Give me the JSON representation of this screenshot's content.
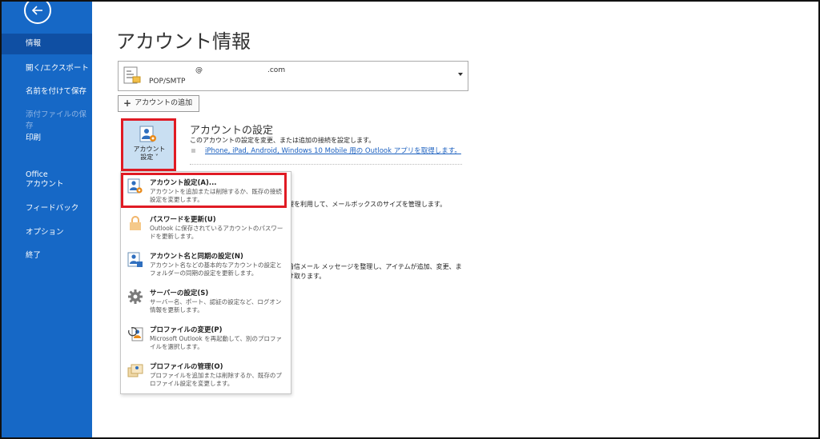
{
  "sidebar": {
    "items": [
      {
        "label": "情報"
      },
      {
        "label": "開く/エクスポート"
      },
      {
        "label": "名前を付けて保存"
      },
      {
        "label": "添付ファイルの保存"
      },
      {
        "label": "印刷"
      },
      {
        "label": "Office\nアカウント"
      },
      {
        "label": "フィードバック"
      },
      {
        "label": "オプション"
      },
      {
        "label": "終了"
      }
    ]
  },
  "main": {
    "title": "アカウント情報",
    "account": {
      "email_at": "@",
      "email_domain": ".com",
      "type": "POP/SMTP"
    },
    "add_account_label": "アカウントの追加",
    "settings_tile_label": "アカウント\n設定 ˅",
    "section": {
      "title": "アカウントの設定",
      "description": "このアカウントの設定を変更、または追加の接続を設定します。",
      "link": "iPhone, iPad, Android, Windows 10 Mobile 用の Outlook アプリを取得します。"
    },
    "background_text": {
      "line1": "理を利用して、メールボックスのサイズを管理します。",
      "line2": "着信メール メッセージを整理し、アイテムが追加、変更、ま",
      "line3": "け取ります。"
    }
  },
  "menu": {
    "items": [
      {
        "title": "アカウント設定(A)...",
        "desc": "アカウントを追加または削除するか、既存の接続設定を変更します。"
      },
      {
        "title": "パスワードを更新(U)",
        "desc": "Outlook に保存されているアカウントのパスワードを更新します。"
      },
      {
        "title": "アカウント名と同期の設定(N)",
        "desc": "アカウント名などの基本的なアカウントの設定とフォルダーの同期の設定を更新します。"
      },
      {
        "title": "サーバーの設定(S)",
        "desc": "サーバー名、ポート、認証の設定など、ログオン情報を更新します。"
      },
      {
        "title": "プロファイルの変更(P)",
        "desc": "Microsoft Outlook を再起動して、別のプロファイルを選択します。"
      },
      {
        "title": "プロファイルの管理(O)",
        "desc": "プロファイルを追加または削除するか、既存のプロファイル設定を変更します。"
      }
    ]
  },
  "colors": {
    "sidebar_bg": "#1668c6",
    "active_item": "#0f4fa3",
    "highlight": "#e01b24",
    "link": "#1a5fbf"
  }
}
